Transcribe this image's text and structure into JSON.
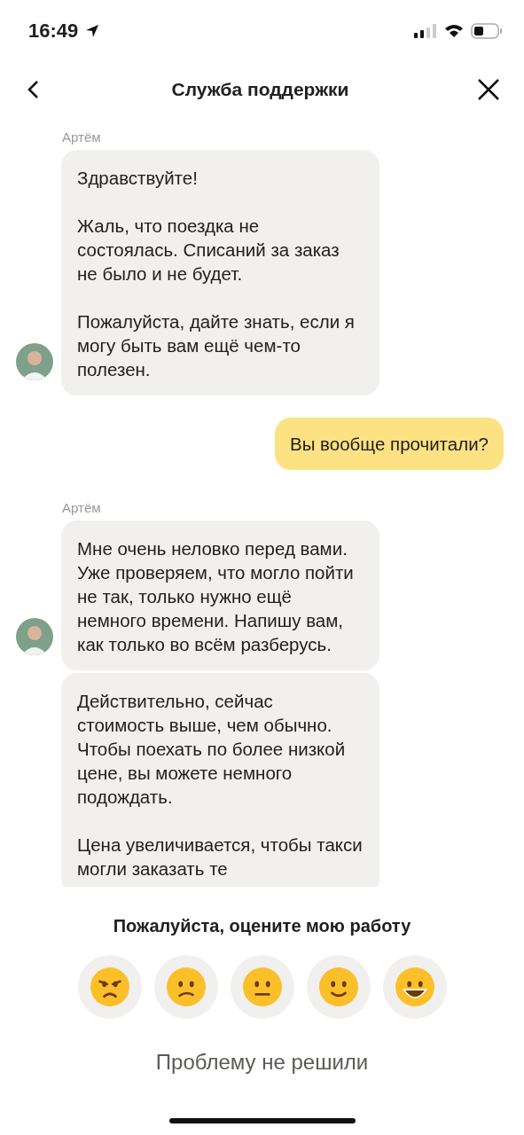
{
  "status_bar": {
    "time": "16:49"
  },
  "header": {
    "title": "Служба поддержки"
  },
  "messages": [
    {
      "kind": "incoming",
      "sender": "Артём",
      "bubbles": [
        {
          "paragraphs": [
            "Здравствуйте!",
            "Жаль, что поездка не состоялась. Списаний за заказ не было и не будет.",
            "Пожалуйста, дайте знать, если я могу быть вам ещё чем-то полезен."
          ]
        }
      ]
    },
    {
      "kind": "outgoing",
      "text": "Вы вообще прочитали?"
    },
    {
      "kind": "incoming",
      "sender": "Артём",
      "bubbles": [
        {
          "paragraphs": [
            "Мне очень неловко перед вами. Уже проверяем, что могло пойти не так, только нужно ещё немного времени. Напишу вам, как только во всём разберусь."
          ]
        },
        {
          "paragraphs": [
            "Действительно, сейчас стоимость выше, чем обычно. Чтобы поехать по более низкой цене, вы можете немного подождать.",
            "Цена увеличивается, чтобы такси могли заказать те"
          ]
        }
      ]
    }
  ],
  "rating": {
    "prompt": "Пожалуйста, оцените мою работу",
    "faces": [
      {
        "kind": "angry"
      },
      {
        "kind": "sad"
      },
      {
        "kind": "neutral"
      },
      {
        "kind": "smile"
      },
      {
        "kind": "grin"
      }
    ]
  },
  "footer_link": "Проблему не решили"
}
